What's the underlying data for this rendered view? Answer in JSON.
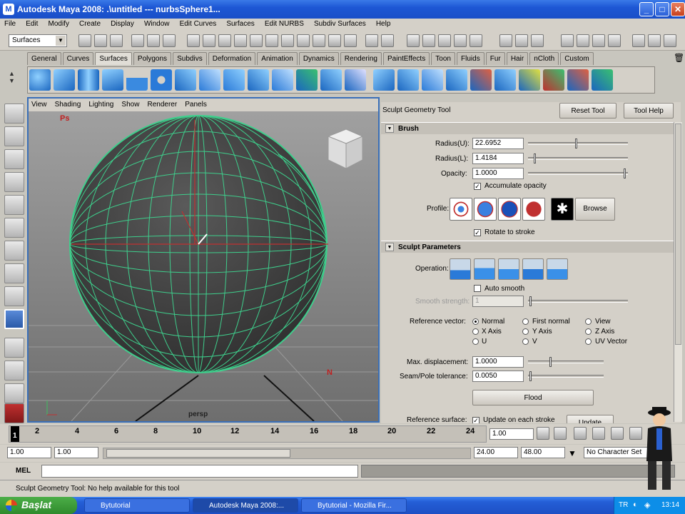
{
  "window": {
    "title": "Autodesk Maya 2008: .\\untitled   ---   nurbsSphere1...",
    "min": "_",
    "max": "□",
    "close": "✕"
  },
  "menubar": [
    "File",
    "Edit",
    "Modify",
    "Create",
    "Display",
    "Window",
    "Edit Curves",
    "Surfaces",
    "Edit NURBS",
    "Subdiv Surfaces",
    "Help"
  ],
  "statusline": {
    "menuset": "Surfaces"
  },
  "shelf_tabs": [
    "General",
    "Curves",
    "Surfaces",
    "Polygons",
    "Subdivs",
    "Deformation",
    "Animation",
    "Dynamics",
    "Rendering",
    "PaintEffects",
    "Toon",
    "Fluids",
    "Fur",
    "Hair",
    "nCloth",
    "Custom"
  ],
  "shelf_active": "Surfaces",
  "viewport": {
    "menu": [
      "View",
      "Shading",
      "Lighting",
      "Show",
      "Renderer",
      "Panels"
    ],
    "camera_label": "persp",
    "marker_ps": "Ps",
    "marker_n": "N"
  },
  "tool_settings": {
    "title": "Sculpt Geometry Tool",
    "reset_button": "Reset Tool",
    "help_button": "Tool Help",
    "brush": {
      "header": "Brush",
      "radius_u_label": "Radius(U):",
      "radius_u": "22.6952",
      "radius_l_label": "Radius(L):",
      "radius_l": "1.4184",
      "opacity_label": "Opacity:",
      "opacity": "1.0000",
      "accumulate_label": "Accumulate opacity",
      "profile_label": "Profile:",
      "browse_button": "Browse",
      "rotate_label": "Rotate to stroke"
    },
    "sculpt": {
      "header": "Sculpt Parameters",
      "operation_label": "Operation:",
      "auto_smooth_label": "Auto smooth",
      "smooth_strength_label": "Smooth strength:",
      "smooth_strength": "1",
      "ref_vector_label": "Reference vector:",
      "ref_options": [
        "Normal",
        "First normal",
        "View",
        "X Axis",
        "Y Axis",
        "Z Axis",
        "U",
        "V",
        "UV Vector"
      ],
      "max_disp_label": "Max. displacement:",
      "max_disp": "1.0000",
      "seam_label": "Seam/Pole tolerance:",
      "seam": "0.0050",
      "flood_button": "Flood",
      "ref_surface_label": "Reference surface:",
      "update_label": "Update on each stroke",
      "update_button": "Update"
    }
  },
  "timeline": {
    "ticks": [
      "2",
      "4",
      "6",
      "8",
      "10",
      "12",
      "14",
      "16",
      "18",
      "20",
      "22",
      "24"
    ],
    "current_frame": "1",
    "current_time": "1.00"
  },
  "range": {
    "start": "1.00",
    "inner_start": "1.00",
    "inner_end": "24.00",
    "end": "48.00",
    "character_set": "No Character Set"
  },
  "command": {
    "label": "MEL"
  },
  "help_line": "Sculpt Geometry Tool: No help available for this tool",
  "taskbar": {
    "start": "Başlat",
    "items": [
      "Bytutorial",
      "Autodesk Maya 2008:...",
      "Bytutorial - Mozilla Fir..."
    ],
    "lang": "TR",
    "clock": "13:14"
  }
}
